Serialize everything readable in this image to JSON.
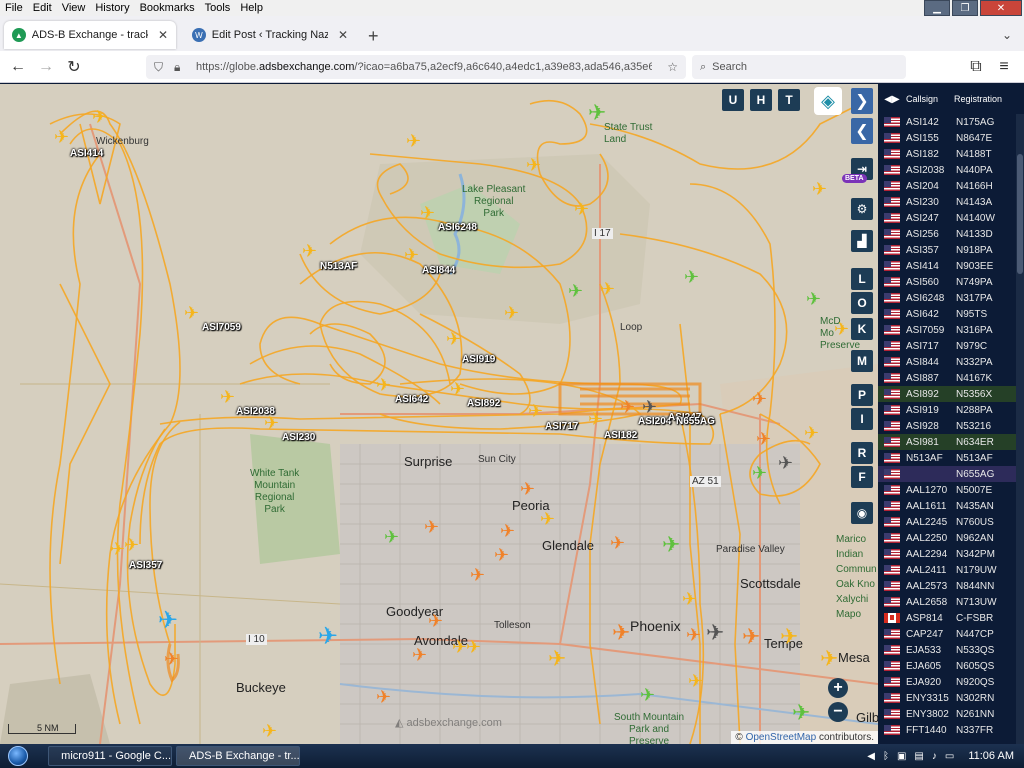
{
  "window": {
    "menu": [
      "File",
      "Edit",
      "View",
      "History",
      "Bookmarks",
      "Tools",
      "Help"
    ]
  },
  "tabs": [
    {
      "label": "ADS-B Exchange - track aircraft",
      "active": true
    },
    {
      "label": "Edit Post ‹ Tracking NaziGuard",
      "active": false
    }
  ],
  "nav": {
    "url_prefix": "https://globe.",
    "url_domain": "adsbexchange.com",
    "url_rest": "/?icao=a6ba75,a2ecf9,a6c640,a4edc1,a39e83,ada546,a35e61,a",
    "search_placeholder": "Search"
  },
  "map": {
    "top_buttons": [
      "U",
      "H",
      "T"
    ],
    "right_buttons": [
      "L",
      "O",
      "K",
      "M",
      "P",
      "I",
      "R",
      "F"
    ],
    "beta_label": "BETA",
    "zoom_in": "+",
    "zoom_out": "−",
    "scale_label": "5 NM",
    "watermark": "adsbexchange.com",
    "attribution_prefix": "© ",
    "attribution_link": "OpenStreetMap",
    "attribution_suffix": " contributors.",
    "places": {
      "wickenburg": "Wickenburg",
      "state_trust": "State Trust\nLand",
      "lake_pleasant": "Lake Pleasant\nRegional\nPark",
      "i17": "I 17",
      "loop": "Loop",
      "mcdowell": "McD\nMo\nPreserve",
      "white_tank": "White Tank\nMountain\nRegional\nPark",
      "surprise": "Surprise",
      "sun_city": "Sun City",
      "az51": "AZ 51",
      "peoria": "Peoria",
      "glendale": "Glendale",
      "paradise_valley": "Paradise Valley",
      "scottsdale": "Scottsdale",
      "goodyear": "Goodyear",
      "avondale": "Avondale",
      "tolleson": "Tolleson",
      "phoenix": "Phoenix",
      "tempe": "Tempe",
      "mesa": "Mesa",
      "buckeye": "Buckeye",
      "i10": "I 10",
      "south_mountain": "South Mountain\nPark and\nPreserve",
      "gilbert": "Gilb",
      "maricopa": "Marico\nIndian\nCommun\nOak Kno\nXalychi\nMapo"
    },
    "callsigns": {
      "asi414": "ASI414",
      "asi6248": "ASI6248",
      "n513af": "N513AF",
      "asi844": "ASI844",
      "asi7059": "ASI7059",
      "asi919": "ASI919",
      "asi642": "ASI642",
      "asi892": "ASI892",
      "asi2038": "ASI2038",
      "asi230": "ASI230",
      "asi717": "ASI717",
      "asi182": "ASI182",
      "asi2047": "ASI204",
      "asi247": "ASI247",
      "n655ag": "N655AG",
      "asi357": "ASI357"
    }
  },
  "sidebar": {
    "header": {
      "callsign": "Callsign",
      "registration": "Registration"
    },
    "rows": [
      {
        "flag": "us",
        "callsign": "ASI142",
        "reg": "N175AG"
      },
      {
        "flag": "us",
        "callsign": "ASI155",
        "reg": "N8647E"
      },
      {
        "flag": "us",
        "callsign": "ASI182",
        "reg": "N4188T"
      },
      {
        "flag": "us",
        "callsign": "ASI2038",
        "reg": "N440PA"
      },
      {
        "flag": "us",
        "callsign": "ASI204",
        "reg": "N4166H"
      },
      {
        "flag": "us",
        "callsign": "ASI230",
        "reg": "N4143A"
      },
      {
        "flag": "us",
        "callsign": "ASI247",
        "reg": "N4140W"
      },
      {
        "flag": "us",
        "callsign": "ASI256",
        "reg": "N4133D"
      },
      {
        "flag": "us",
        "callsign": "ASI357",
        "reg": "N918PA"
      },
      {
        "flag": "us",
        "callsign": "ASI414",
        "reg": "N903EE"
      },
      {
        "flag": "us",
        "callsign": "ASI560",
        "reg": "N749PA"
      },
      {
        "flag": "us",
        "callsign": "ASI6248",
        "reg": "N317PA"
      },
      {
        "flag": "us",
        "callsign": "ASI642",
        "reg": "N95TS"
      },
      {
        "flag": "us",
        "callsign": "ASI7059",
        "reg": "N316PA"
      },
      {
        "flag": "us",
        "callsign": "ASI717",
        "reg": "N979C"
      },
      {
        "flag": "us",
        "callsign": "ASI844",
        "reg": "N332PA"
      },
      {
        "flag": "us",
        "callsign": "ASI887",
        "reg": "N4167K"
      },
      {
        "flag": "us",
        "callsign": "ASI892",
        "reg": "N5356X",
        "hl": true
      },
      {
        "flag": "us",
        "callsign": "ASI919",
        "reg": "N288PA"
      },
      {
        "flag": "us",
        "callsign": "ASI928",
        "reg": "N53216"
      },
      {
        "flag": "us",
        "callsign": "ASI981",
        "reg": "N634ER",
        "hl": true
      },
      {
        "flag": "us",
        "callsign": "N513AF",
        "reg": "N513AF"
      },
      {
        "flag": "us",
        "callsign": "",
        "reg": "N655AG",
        "sel": true
      },
      {
        "flag": "us",
        "callsign": "AAL1270",
        "reg": "N5007E"
      },
      {
        "flag": "us",
        "callsign": "AAL1611",
        "reg": "N435AN"
      },
      {
        "flag": "us",
        "callsign": "AAL2245",
        "reg": "N760US"
      },
      {
        "flag": "us",
        "callsign": "AAL2250",
        "reg": "N962AN"
      },
      {
        "flag": "us",
        "callsign": "AAL2294",
        "reg": "N342PM"
      },
      {
        "flag": "us",
        "callsign": "AAL2411",
        "reg": "N179UW"
      },
      {
        "flag": "us",
        "callsign": "AAL2573",
        "reg": "N844NN"
      },
      {
        "flag": "us",
        "callsign": "AAL2658",
        "reg": "N713UW"
      },
      {
        "flag": "ca",
        "callsign": "ASP814",
        "reg": "C-FSBR"
      },
      {
        "flag": "us",
        "callsign": "CAP247",
        "reg": "N447CP"
      },
      {
        "flag": "us",
        "callsign": "EJA533",
        "reg": "N533QS"
      },
      {
        "flag": "us",
        "callsign": "EJA605",
        "reg": "N605QS"
      },
      {
        "flag": "us",
        "callsign": "EJA920",
        "reg": "N920QS"
      },
      {
        "flag": "us",
        "callsign": "ENY3315",
        "reg": "N302RN"
      },
      {
        "flag": "us",
        "callsign": "ENY3802",
        "reg": "N261NN"
      },
      {
        "flag": "us",
        "callsign": "FFT1440",
        "reg": "N337FR"
      }
    ]
  },
  "taskbar": {
    "items": [
      {
        "label": "micro911 - Google C...",
        "active": false
      },
      {
        "label": "ADS-B Exchange - tr...",
        "active": true
      }
    ],
    "clock": "11:06 AM"
  },
  "colors": {
    "track": "#f5a623",
    "plane_yellow": "#f5b51c",
    "plane_orange": "#f0822a",
    "plane_green": "#5fc13e",
    "plane_blue": "#2aa6e8",
    "sidebar_bg": "#0c1b36",
    "button_bg": "#1d3c55"
  }
}
